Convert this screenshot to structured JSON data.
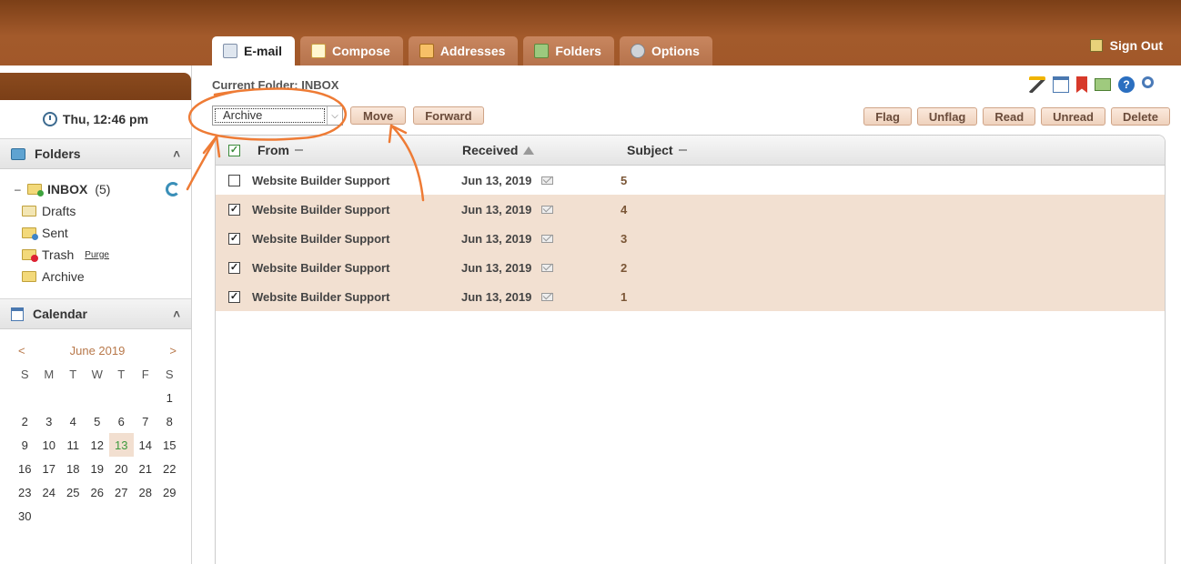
{
  "header": {
    "tabs": [
      {
        "label": "E-mail",
        "icon": "mail-icon",
        "active": true
      },
      {
        "label": "Compose",
        "icon": "compose-icon",
        "active": false
      },
      {
        "label": "Addresses",
        "icon": "address-book-icon",
        "active": false
      },
      {
        "label": "Folders",
        "icon": "folder-icon",
        "active": false
      },
      {
        "label": "Options",
        "icon": "gear-icon",
        "active": false
      }
    ],
    "signout_label": "Sign Out"
  },
  "sidebar": {
    "datetime": "Thu, 12:46 pm",
    "folders_title": "Folders",
    "folders": {
      "inbox": {
        "label": "INBOX",
        "count": "(5)"
      },
      "drafts": {
        "label": "Drafts"
      },
      "sent": {
        "label": "Sent"
      },
      "trash": {
        "label": "Trash",
        "purge": "Purge"
      },
      "archive": {
        "label": "Archive"
      }
    },
    "calendar_title": "Calendar",
    "calendar": {
      "prev": "<",
      "month": "June 2019",
      "next": ">",
      "dow": [
        "S",
        "M",
        "T",
        "W",
        "T",
        "F",
        "S"
      ],
      "first_weekday": 6,
      "days": 30,
      "today": 13
    }
  },
  "main": {
    "current_folder": "Current Folder: INBOX",
    "move_target": "Archive",
    "move_label": "Move",
    "forward_label": "Forward",
    "right_buttons": [
      "Flag",
      "Unflag",
      "Read",
      "Unread",
      "Delete"
    ],
    "columns": {
      "from": "From",
      "received": "Received",
      "subject": "Subject"
    },
    "messages": [
      {
        "from": "Website Builder Support",
        "date": "Jun 13, 2019",
        "subject": "5",
        "checked": false
      },
      {
        "from": "Website Builder Support",
        "date": "Jun 13, 2019",
        "subject": "4",
        "checked": true
      },
      {
        "from": "Website Builder Support",
        "date": "Jun 13, 2019",
        "subject": "3",
        "checked": true
      },
      {
        "from": "Website Builder Support",
        "date": "Jun 13, 2019",
        "subject": "2",
        "checked": true
      },
      {
        "from": "Website Builder Support",
        "date": "Jun 13, 2019",
        "subject": "1",
        "checked": true
      }
    ]
  },
  "colors": {
    "header_brown": "#a1582a",
    "tab_inactive": "#b6734c",
    "selected_row": "#f2e0d1",
    "annotation_orange": "#ee7b35"
  }
}
